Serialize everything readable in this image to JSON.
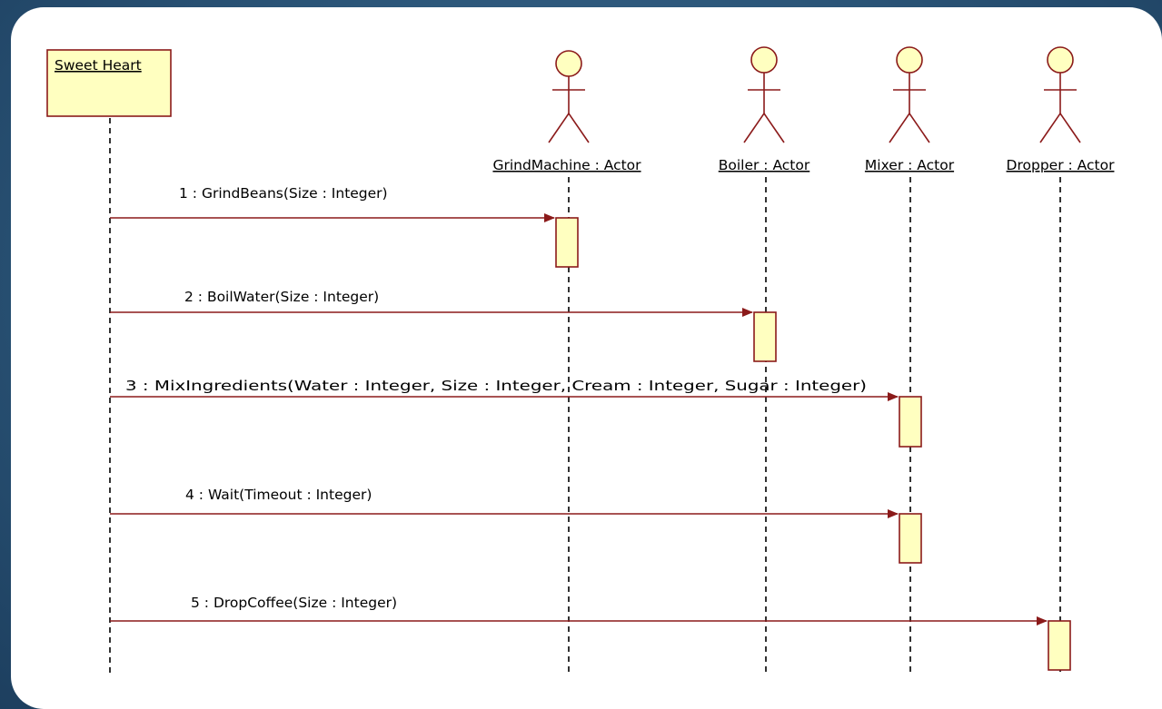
{
  "diagram": {
    "object": "Sweet Heart",
    "actors": [
      "GrindMachine : Actor",
      "Boiler : Actor",
      "Mixer : Actor",
      "Dropper : Actor"
    ],
    "messages": [
      "1 : GrindBeans(Size : Integer)",
      "2 : BoilWater(Size : Integer)",
      "3 : MixIngredients(Water : Integer, Size : Integer, Cream : Integer, Sugar : Integer)",
      "4 : Wait(Timeout : Integer)",
      "5 : DropCoffee(Size : Integer)"
    ],
    "colors": {
      "line": "#8b1a1a",
      "fill": "#ffffc0",
      "background": "#2b5578"
    }
  }
}
